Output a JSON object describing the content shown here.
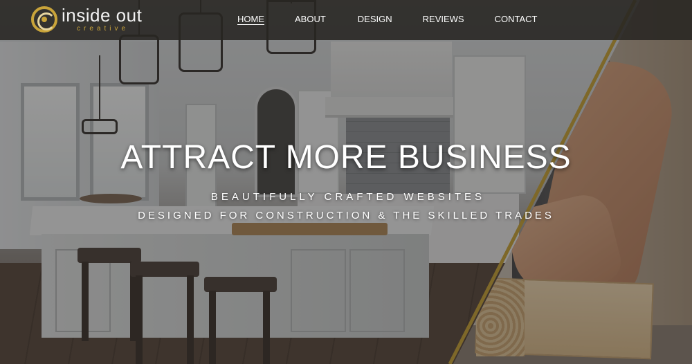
{
  "brand": {
    "name": "inside out",
    "tagline": "creative",
    "logo_icon": "swirl-logo-icon",
    "accent_color": "#c9a43a"
  },
  "nav": {
    "items": [
      {
        "label": "HOME",
        "active": true
      },
      {
        "label": "ABOUT",
        "active": false
      },
      {
        "label": "DESIGN",
        "active": false
      },
      {
        "label": "REVIEWS",
        "active": false
      },
      {
        "label": "CONTACT",
        "active": false
      }
    ]
  },
  "hero": {
    "headline": "ATTRACT MORE BUSINESS",
    "subline_1": "BEAUTIFULLY CRAFTED WEBSITES",
    "subline_2": "DESIGNED FOR CONSTRUCTION & THE SKILLED TRADES"
  }
}
